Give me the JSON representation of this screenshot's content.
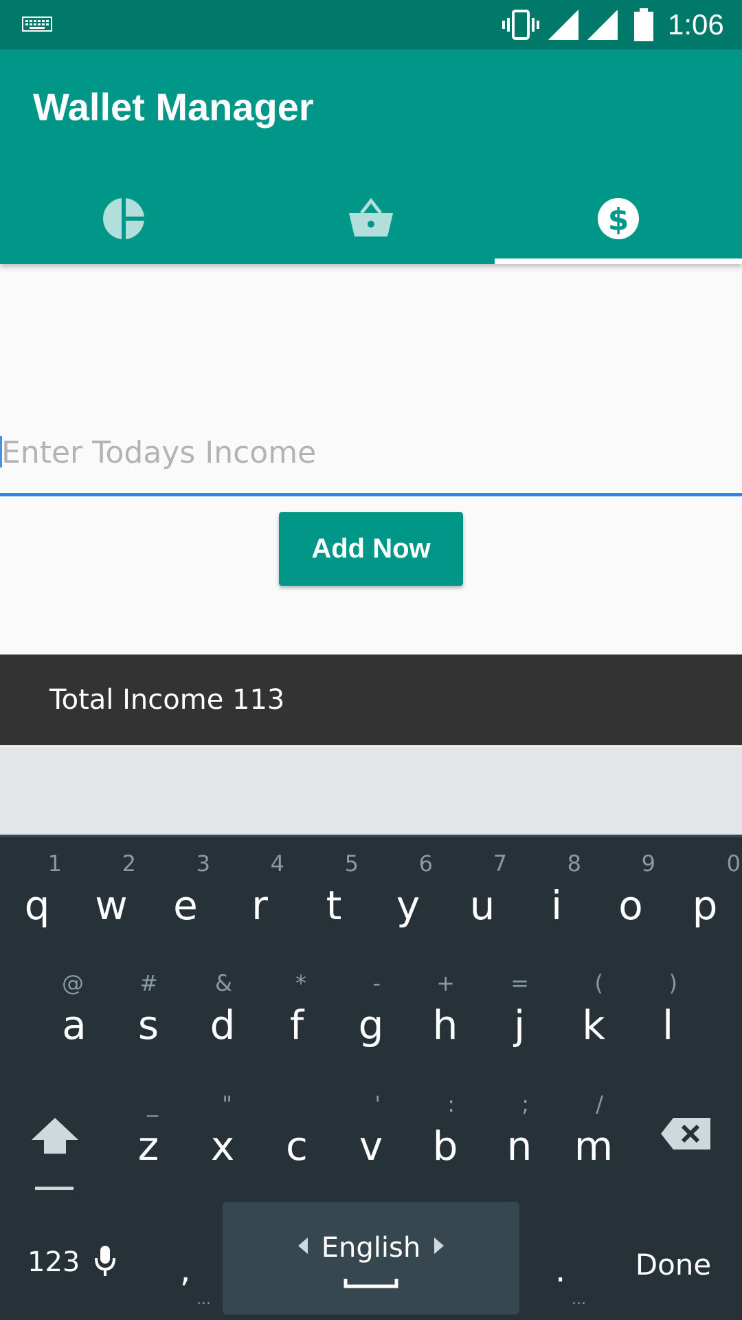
{
  "status_bar": {
    "time": "1:06",
    "icons": [
      "keyboard-icon",
      "vibrate-icon",
      "signal-icon",
      "signal-icon",
      "battery-icon"
    ]
  },
  "app": {
    "title": "Wallet Manager",
    "tabs": [
      {
        "name": "pie-chart-icon",
        "selected": false
      },
      {
        "name": "basket-icon",
        "selected": false
      },
      {
        "name": "dollar-icon",
        "selected": true
      }
    ],
    "primary_color": "#009688",
    "status_color": "#00796b"
  },
  "income": {
    "placeholder": "Enter Todays Income",
    "value": "",
    "button_label": "Add Now",
    "total_label": "Total Income 113"
  },
  "keyboard": {
    "row1": [
      {
        "key": "q",
        "hint": "1"
      },
      {
        "key": "w",
        "hint": "2"
      },
      {
        "key": "e",
        "hint": "3"
      },
      {
        "key": "r",
        "hint": "4"
      },
      {
        "key": "t",
        "hint": "5"
      },
      {
        "key": "y",
        "hint": "6"
      },
      {
        "key": "u",
        "hint": "7"
      },
      {
        "key": "i",
        "hint": "8"
      },
      {
        "key": "o",
        "hint": "9"
      },
      {
        "key": "p",
        "hint": "0"
      }
    ],
    "row2": [
      {
        "key": "a",
        "hint": "@"
      },
      {
        "key": "s",
        "hint": "#"
      },
      {
        "key": "d",
        "hint": "&"
      },
      {
        "key": "f",
        "hint": "*"
      },
      {
        "key": "g",
        "hint": "-"
      },
      {
        "key": "h",
        "hint": "+"
      },
      {
        "key": "j",
        "hint": "="
      },
      {
        "key": "k",
        "hint": "("
      },
      {
        "key": "l",
        "hint": ")"
      }
    ],
    "row3": [
      {
        "key": "z",
        "hint": "_"
      },
      {
        "key": "x",
        "hint": "\""
      },
      {
        "key": "c",
        "hint": ""
      },
      {
        "key": "v",
        "hint": "'"
      },
      {
        "key": "b",
        "hint": ":"
      },
      {
        "key": "n",
        "hint": ";"
      },
      {
        "key": "m",
        "hint": "/"
      }
    ],
    "numbers_label": "123",
    "comma": ",",
    "period": ".",
    "dots": "...",
    "space_label": "English",
    "done_label": "Done"
  }
}
